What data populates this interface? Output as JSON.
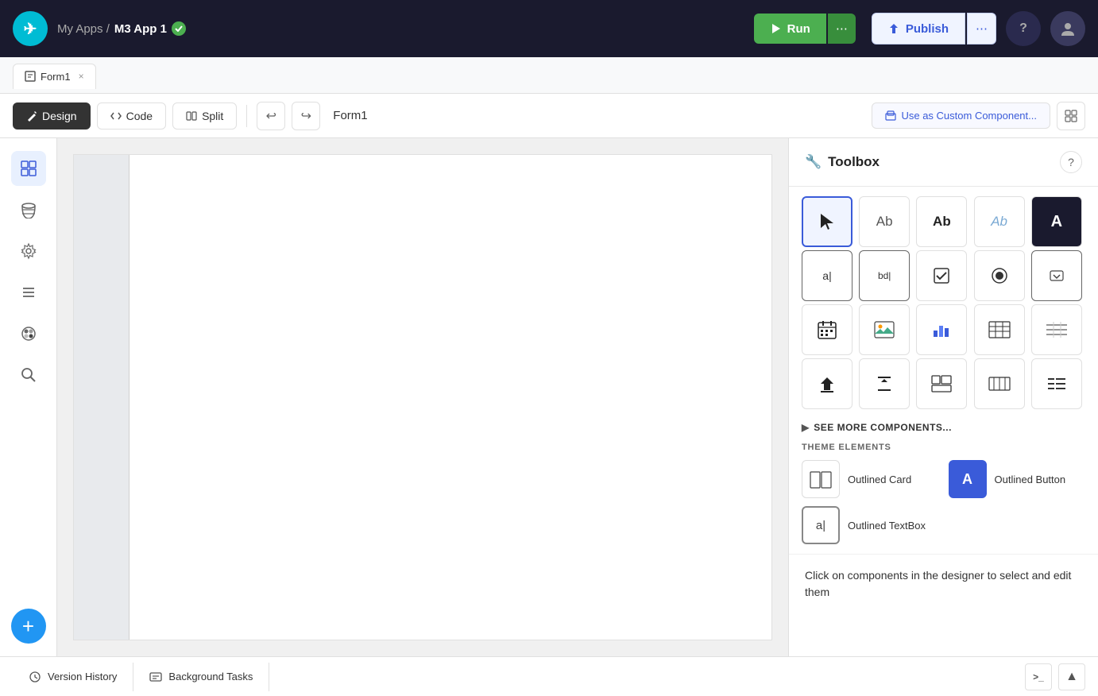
{
  "header": {
    "logo_text": "✈",
    "breadcrumb_prefix": "My Apps /",
    "app_name": "M3 App 1",
    "run_label": "Run",
    "more_label": "⋯",
    "publish_label": "Publish",
    "help_icon": "?",
    "avatar_icon": "👤"
  },
  "tabs": [
    {
      "label": "Form1",
      "icon": "📋",
      "active": true
    }
  ],
  "toolbar": {
    "design_label": "Design",
    "code_label": "Code",
    "split_label": "Split",
    "undo_icon": "↩",
    "redo_icon": "↪",
    "form_name": "Form1",
    "custom_component_label": "Use as Custom Component...",
    "grid_icon": "⊞"
  },
  "sidebar": {
    "items": [
      {
        "icon": "⊞",
        "name": "components",
        "active": true
      },
      {
        "icon": "🗄",
        "name": "database",
        "active": false
      },
      {
        "icon": "⚙",
        "name": "settings",
        "active": false
      },
      {
        "icon": "☰",
        "name": "list",
        "active": false
      },
      {
        "icon": "🎨",
        "name": "theme",
        "active": false
      },
      {
        "icon": "🔍",
        "name": "search",
        "active": false
      }
    ],
    "add_label": "+"
  },
  "toolbox": {
    "title": "Toolbox",
    "title_icon": "🔧",
    "help_icon": "?",
    "tools": [
      {
        "icon": "↖",
        "name": "cursor",
        "selected": true
      },
      {
        "icon": "Ab",
        "name": "text-label",
        "selected": false
      },
      {
        "icon": "Ab",
        "name": "text-bold",
        "selected": false
      },
      {
        "icon": "Ab",
        "name": "text-thin",
        "selected": false
      },
      {
        "icon": "A",
        "name": "text-filled",
        "selected": false
      },
      {
        "icon": "a|",
        "name": "input",
        "selected": false
      },
      {
        "icon": "bd|",
        "name": "multiline-input",
        "selected": false
      },
      {
        "icon": "☑",
        "name": "checkbox",
        "selected": false
      },
      {
        "icon": "◉",
        "name": "radio",
        "selected": false
      },
      {
        "icon": "▼",
        "name": "dropdown",
        "selected": false
      },
      {
        "icon": "📅",
        "name": "calendar",
        "selected": false
      },
      {
        "icon": "🖼",
        "name": "image",
        "selected": false
      },
      {
        "icon": "📊",
        "name": "chart",
        "selected": false
      },
      {
        "icon": "≡≡",
        "name": "data-grid",
        "selected": false
      },
      {
        "icon": "⋯⋯",
        "name": "form-grid",
        "selected": false
      },
      {
        "icon": "⬆",
        "name": "upload",
        "selected": false
      },
      {
        "icon": "⊤",
        "name": "separator-h",
        "selected": false
      },
      {
        "icon": "⊞",
        "name": "layout",
        "selected": false
      },
      {
        "icon": "⊟",
        "name": "horizontal-stack",
        "selected": false
      },
      {
        "icon": "☰",
        "name": "list-view",
        "selected": false
      }
    ],
    "see_more_label": "▶ SEE MORE COMPONENTS...",
    "theme_section_label": "THEME ELEMENTS",
    "theme_elements": [
      {
        "icon": "⊞",
        "name": "outlined-card",
        "label": "Outlined Card",
        "filled": false
      },
      {
        "icon": "A",
        "name": "outlined-button",
        "label": "Outlined Button",
        "filled": true
      },
      {
        "icon": "a|",
        "name": "outlined-textbox",
        "label": "Outlined TextBox",
        "filled": false
      }
    ],
    "hint": "Click on components in the designer to select and edit them"
  },
  "bottom_bar": {
    "version_history_icon": "⎇",
    "version_history_label": "Version History",
    "background_tasks_icon": "≡",
    "background_tasks_label": "Background Tasks",
    "terminal_icon": ">_",
    "expand_icon": "▲"
  }
}
